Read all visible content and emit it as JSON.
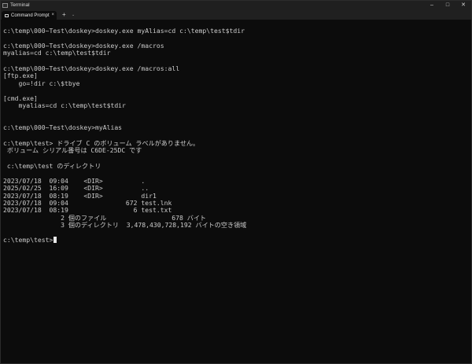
{
  "window": {
    "title": "Terminal",
    "minimize_glyph": "–",
    "maximize_glyph": "□",
    "close_glyph": "✕"
  },
  "tabs": {
    "active_label": "Command Prompt",
    "close_glyph": "×",
    "add_glyph": "+",
    "dropdown_glyph": "⌄"
  },
  "console": {
    "lines": [
      "c:\\temp\\000~Test\\doskey>doskey.exe myAlias=cd c:\\temp\\test$tdir",
      "c:\\temp\\000~Test\\doskey>doskey.exe /macros",
      "myalias=cd c:\\temp\\test$tdir",
      "c:\\temp\\000~Test\\doskey>doskey.exe /macros:all",
      "[ftp.exe]",
      "    go=!dir c:\\$tbye",
      "[cmd.exe]",
      "    myalias=cd c:\\temp\\test$tdir",
      "c:\\temp\\000~Test\\doskey>myAlias",
      "c:\\temp\\test> ドライブ C のボリューム ラベルがありません。",
      " ボリューム シリアル番号は C6DE-25DC です",
      " c:\\temp\\test のディレクトリ",
      "2023/07/18  09:04    <DIR>          .",
      "2025/02/25  16:09    <DIR>          ..",
      "2023/07/18  08:19    <DIR>          dir1",
      "2023/07/18  09:04               672 test.lnk",
      "2023/07/18  08:19                 6 test.txt",
      "               2 個のファイル                 678 バイト",
      "               3 個のディレクトリ  3,478,430,728,192 バイトの空き領域",
      "c:\\temp\\test>"
    ]
  }
}
